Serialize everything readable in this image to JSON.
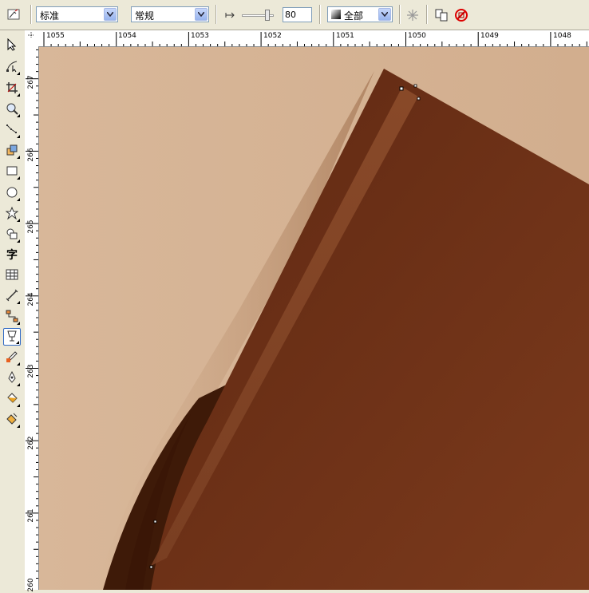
{
  "toolbar": {
    "style_combo": "标准",
    "weight_combo": "常规",
    "opacity_value": "80",
    "opacity_fraction": 0.8,
    "target_combo": "全部"
  },
  "ruler": {
    "h_labels": [
      "1055",
      "1054",
      "1053",
      "1052",
      "1051",
      "1050",
      "1049",
      "1048"
    ],
    "v_labels": [
      "267",
      "266",
      "265",
      "264",
      "263",
      "262",
      "261",
      "260"
    ]
  },
  "tools": [
    {
      "name": "pick-tool-icon"
    },
    {
      "name": "shape-tool-icon"
    },
    {
      "name": "crop-tool-icon"
    },
    {
      "name": "zoom-tool-icon"
    },
    {
      "name": "freehand-tool-icon"
    },
    {
      "name": "smart-fill-tool-icon"
    },
    {
      "name": "rectangle-tool-icon"
    },
    {
      "name": "ellipse-tool-icon"
    },
    {
      "name": "polygon-tool-icon"
    },
    {
      "name": "basic-shapes-tool-icon"
    },
    {
      "name": "text-tool-icon",
      "glyph": "字"
    },
    {
      "name": "table-tool-icon"
    },
    {
      "name": "dimension-tool-icon"
    },
    {
      "name": "connector-tool-icon"
    },
    {
      "name": "transparency-tool-icon"
    },
    {
      "name": "eyedropper-tool-icon"
    },
    {
      "name": "outline-pen-tool-icon"
    },
    {
      "name": "fill-tool-icon"
    },
    {
      "name": "interactive-fill-tool-icon"
    }
  ],
  "colors": {
    "canvas_bg": "#D7B698",
    "shape_dark": "#6A2E14",
    "shape_mid": "#7A3818",
    "highlight": "#8A4A2A"
  }
}
